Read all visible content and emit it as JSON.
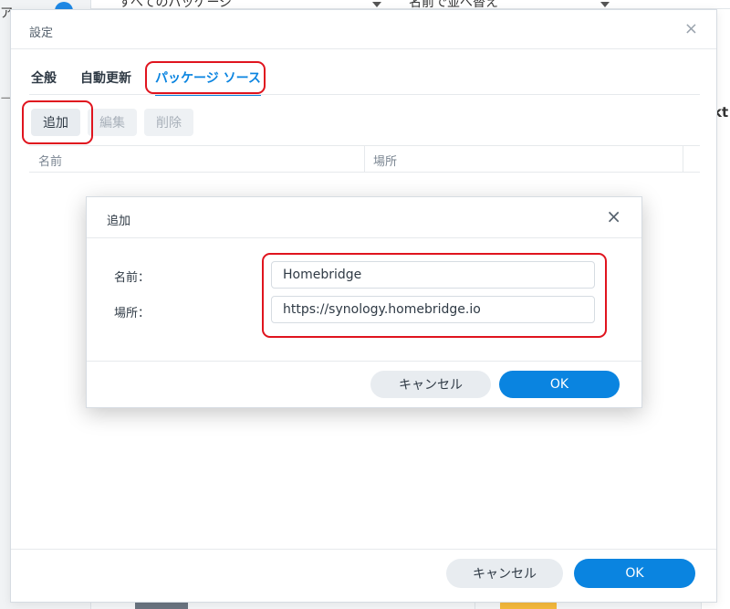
{
  "background": {
    "left_text_top": "ア",
    "left_text_mid": "ージ",
    "filter_packages": "すべてのパッケージ",
    "sort_by": "名前で並べ替え",
    "right_text": "kt"
  },
  "settings": {
    "title": "設定",
    "close_icon": "×",
    "tabs": [
      {
        "label": "全般"
      },
      {
        "label": "自動更新"
      },
      {
        "label": "パッケージ ソース"
      }
    ],
    "active_tab": "パッケージ ソース",
    "toolbar": {
      "add_label": "追加",
      "edit_label": "編集",
      "delete_label": "削除"
    },
    "grid": {
      "columns": [
        "名前",
        "場所"
      ]
    },
    "footer": {
      "cancel_label": "キャンセル",
      "ok_label": "OK"
    }
  },
  "add_dialog": {
    "title": "追加",
    "close_icon": "×",
    "fields": {
      "name_label": "名前：",
      "name_value": "Homebridge",
      "location_label": "場所：",
      "location_value": "https://synology.homebridge.io"
    },
    "footer": {
      "cancel_label": "キャンセル",
      "ok_label": "OK"
    }
  },
  "colors": {
    "accent": "#0a84e0",
    "annotation": "#e0141e"
  }
}
